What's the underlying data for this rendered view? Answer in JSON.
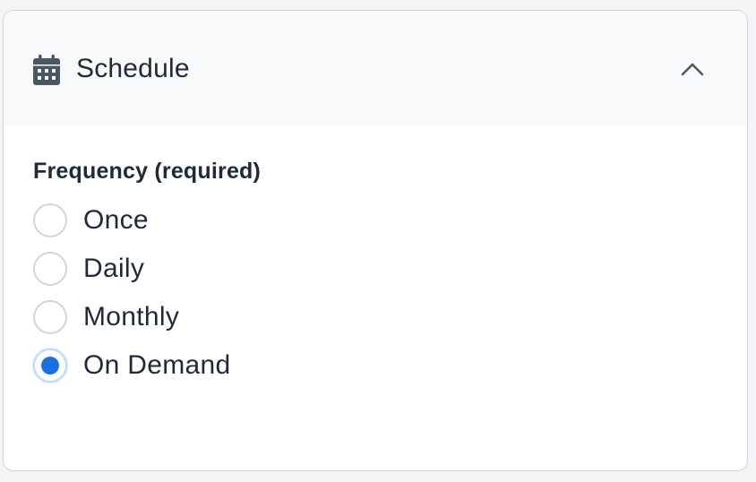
{
  "panel": {
    "title": "Schedule",
    "header_icon": "calendar-icon",
    "toggle_icon": "chevron-up-icon",
    "expanded": true
  },
  "frequency": {
    "label": "Frequency (required)",
    "options": [
      {
        "label": "Once",
        "selected": false
      },
      {
        "label": "Daily",
        "selected": false
      },
      {
        "label": "Monthly",
        "selected": false
      },
      {
        "label": "On Demand",
        "selected": true
      }
    ]
  },
  "colors": {
    "accent": "#1d6fe0",
    "header_bg": "#f8f9fb",
    "border": "#d1d5db",
    "text": "#1f2937",
    "icon": "#4b5563"
  }
}
